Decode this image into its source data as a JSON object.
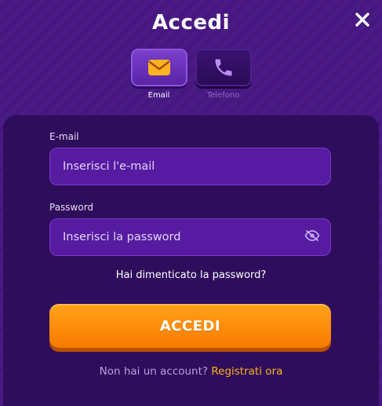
{
  "header": {
    "title": "Accedi",
    "close_icon": "close-icon"
  },
  "tabs": [
    {
      "label": "Email",
      "icon": "envelope-icon",
      "active": true
    },
    {
      "label": "Telefono",
      "icon": "phone-icon",
      "active": false
    }
  ],
  "form": {
    "email_label": "E-mail",
    "email_placeholder": "Inserisci l'e-mail",
    "email_value": "",
    "password_label": "Password",
    "password_placeholder": "Inserisci la password",
    "password_value": "",
    "password_toggle_icon": "eye-slash-icon",
    "forgot_label": "Hai dimenticato la password?",
    "submit_label": "ACCEDI",
    "signup_prompt": "Non hai un account?",
    "signup_link": "Registrati ora"
  },
  "colors": {
    "accent": "#ff8a0a",
    "link": "#ffb21f",
    "background": "#4a1a86",
    "input_bg": "#561ba0"
  }
}
